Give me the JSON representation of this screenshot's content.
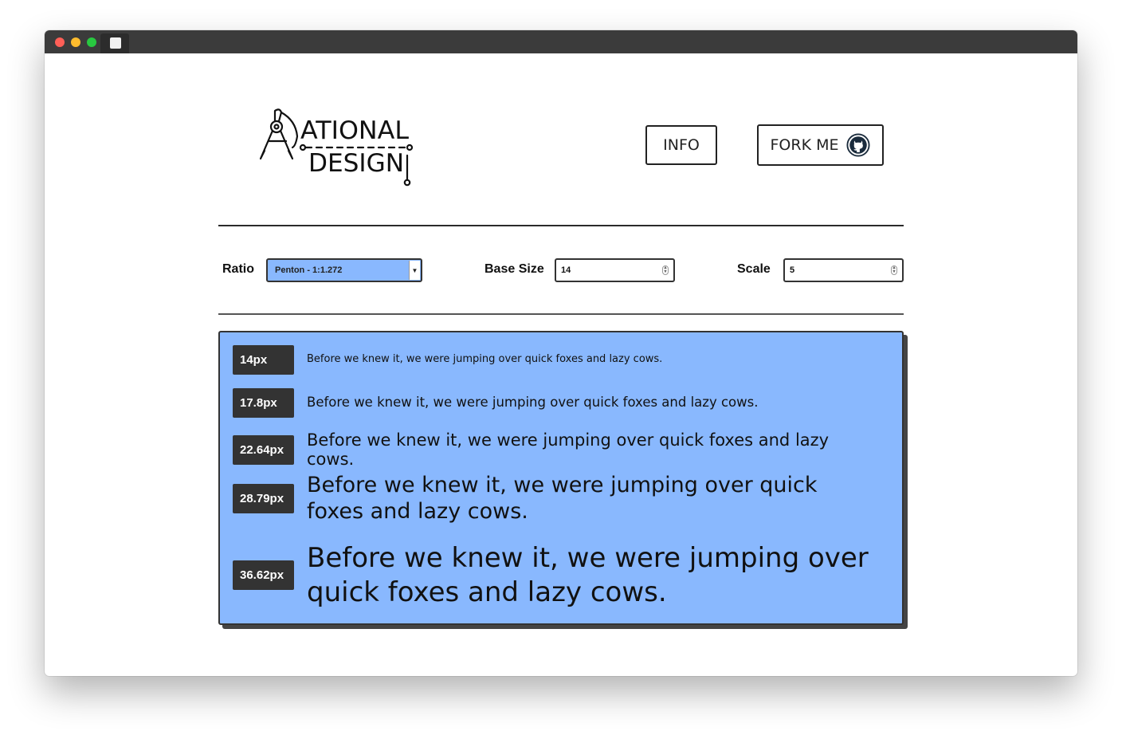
{
  "header": {
    "logo_text": "RATIONAL DESIGN",
    "nav": {
      "info_label": "INFO",
      "fork_label": "FORK ME"
    }
  },
  "controls": {
    "ratio_label": "Ratio",
    "ratio_value": "Penton - 1:1.272",
    "base_size_label": "Base Size",
    "base_size_value": "14",
    "scale_label": "Scale",
    "scale_value": "5"
  },
  "preview": {
    "sample_text": "Before we knew it, we were jumping over quick foxes and lazy cows.",
    "rows": [
      {
        "size_label": "14px"
      },
      {
        "size_label": "17.8px"
      },
      {
        "size_label": "22.64px"
      },
      {
        "size_label": "28.79px"
      },
      {
        "size_label": "36.62px"
      }
    ]
  },
  "colors": {
    "accent_blue": "#89b8fe",
    "dark": "#333333",
    "titlebar": "#3b3b3b"
  }
}
